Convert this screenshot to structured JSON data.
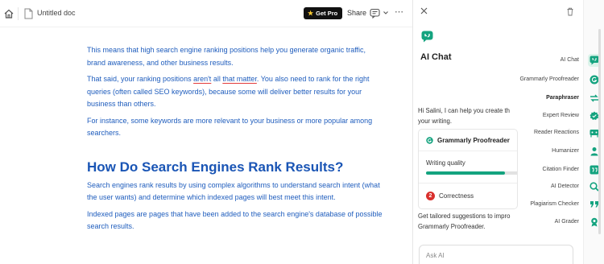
{
  "topbar": {
    "doc_title": "Untitled doc",
    "get_pro_label": "Get Pro",
    "share_label": "Share",
    "more_label": "⋯"
  },
  "document": {
    "p1": "This means that high search engine ranking positions help you generate organic traffic, brand awareness, and other business results.",
    "p2_a": "That said, your ranking positions ",
    "p2_u1": "aren't",
    "p2_b": " all ",
    "p2_u2": "that matter",
    "p2_c": ". You also need to rank for the right queries (often called SEO keywords), because some will deliver better results for your business than others.",
    "p3": "For instance, some keywords are more relevant to your business or more popular among searchers.",
    "heading": "How Do Search Engines Rank Results?",
    "p4": "Search engines rank results by using complex algorithms to understand search intent (what the user wants) and determine which indexed pages will best meet this intent.",
    "p5": "Indexed pages are pages that have been added to the search engine's database of possible search results."
  },
  "panel": {
    "title": "AI Chat",
    "greeting": "Hi Salini, I can help you create th your writing.",
    "card": {
      "title": "Grammarly Proofreader",
      "writing_quality": "Writing quality",
      "writing_quality_fraction": 0.85,
      "correctness": "Correctness",
      "correctness_count": "2"
    },
    "tailored": "Get tailored suggestions to impro Grammarly Proofreader.",
    "ask_placeholder": "Ask AI"
  },
  "menu": {
    "items": [
      {
        "label": "AI Chat",
        "bold": false
      },
      {
        "label": "Grammarly Proofreader",
        "bold": false
      },
      {
        "label": "Paraphraser",
        "bold": true
      },
      {
        "label": "Expert Review",
        "bold": false
      },
      {
        "label": "Reader Reactions",
        "bold": false
      },
      {
        "label": "Humanizer",
        "bold": false
      },
      {
        "label": "Citation Finder",
        "bold": false
      },
      {
        "label": "AI Detector",
        "bold": false
      },
      {
        "label": "Plagiarism Checker",
        "bold": false
      },
      {
        "label": "AI Grader",
        "bold": false
      }
    ]
  },
  "colors": {
    "accent": "#14a37f",
    "doc_text": "#1f5dbd",
    "error": "#d9302d"
  }
}
